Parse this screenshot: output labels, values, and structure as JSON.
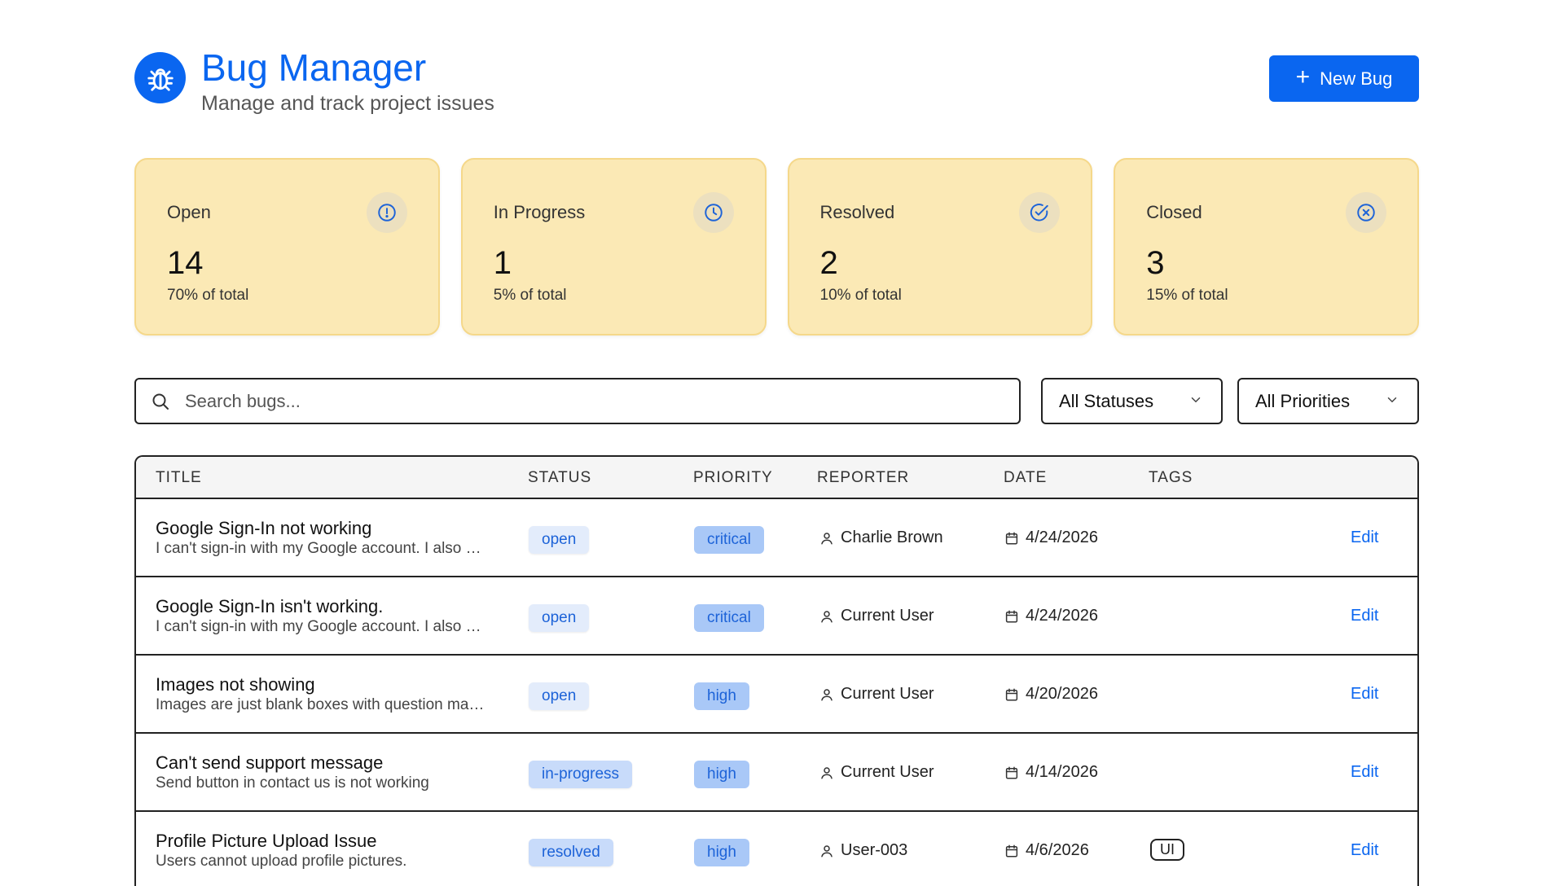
{
  "header": {
    "title": "Bug Manager",
    "subtitle": "Manage and track project issues",
    "new_bug_label": "New Bug"
  },
  "stats": [
    {
      "label": "Open",
      "value": "14",
      "sub": "70% of total",
      "icon": "alert-circle-icon"
    },
    {
      "label": "In Progress",
      "value": "1",
      "sub": "5% of total",
      "icon": "clock-icon"
    },
    {
      "label": "Resolved",
      "value": "2",
      "sub": "10% of total",
      "icon": "check-circle-icon"
    },
    {
      "label": "Closed",
      "value": "3",
      "sub": "15% of total",
      "icon": "x-circle-icon"
    }
  ],
  "filters": {
    "search_placeholder": "Search bugs...",
    "status_value": "All Statuses",
    "priority_value": "All Priorities"
  },
  "table": {
    "headers": [
      "TITLE",
      "STATUS",
      "PRIORITY",
      "REPORTER",
      "DATE",
      "TAGS"
    ],
    "edit_label": "Edit",
    "rows": [
      {
        "title": "Google Sign-In not working",
        "desc": "I can't sign-in with my Google account. I also …",
        "status": "open",
        "priority": "critical",
        "reporter": "Charlie Brown",
        "date": "4/24/2026",
        "tag": ""
      },
      {
        "title": "Google Sign-In isn't working.",
        "desc": "I can't sign-in with my Google account. I also …",
        "status": "open",
        "priority": "critical",
        "reporter": "Current User",
        "date": "4/24/2026",
        "tag": ""
      },
      {
        "title": "Images not showing",
        "desc": "Images are just blank boxes with question ma…",
        "status": "open",
        "priority": "high",
        "reporter": "Current User",
        "date": "4/20/2026",
        "tag": ""
      },
      {
        "title": "Can't send support message",
        "desc": "Send button in contact us is not working",
        "status": "in-progress",
        "priority": "high",
        "reporter": "Current User",
        "date": "4/14/2026",
        "tag": ""
      },
      {
        "title": "Profile Picture Upload Issue",
        "desc": "Users cannot upload profile pictures.",
        "status": "resolved",
        "priority": "high",
        "reporter": "User-003",
        "date": "4/6/2026",
        "tag": "UI"
      }
    ]
  },
  "colors": {
    "accent": "#0a66f0",
    "card_bg": "#fbe9b5"
  }
}
